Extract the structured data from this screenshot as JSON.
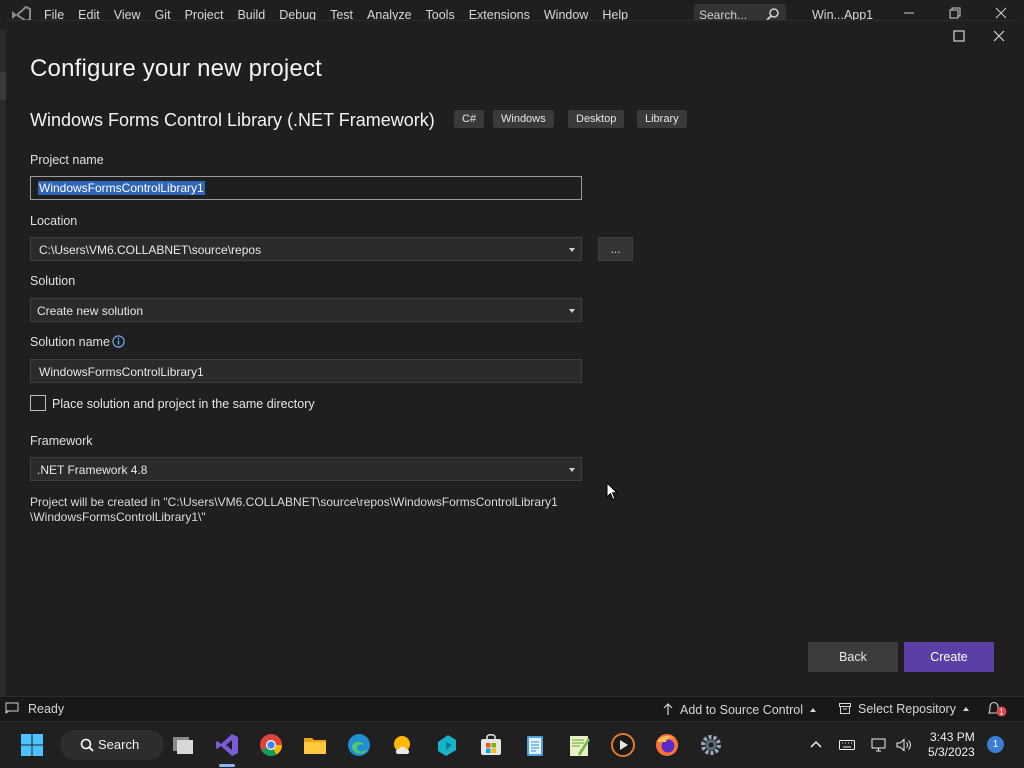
{
  "app": {
    "menu": [
      "File",
      "Edit",
      "View",
      "Git",
      "Project",
      "Build",
      "Debug",
      "Test",
      "Analyze",
      "Tools",
      "Extensions",
      "Window",
      "Help"
    ],
    "search_placeholder": "Search...",
    "window_title": "Win...App1"
  },
  "dialog": {
    "title": "Configure your new project",
    "template_name": "Windows Forms Control Library (.NET Framework)",
    "tags": [
      "C#",
      "Windows",
      "Desktop",
      "Library"
    ],
    "project_name_label": "Project name",
    "project_name_value": "WindowsFormsControlLibrary1",
    "location_label": "Location",
    "location_value": "C:\\Users\\VM6.COLLABNET\\source\\repos",
    "browse_label": "...",
    "solution_label": "Solution",
    "solution_value": "Create new solution",
    "solution_name_label": "Solution name",
    "solution_name_value": "WindowsFormsControlLibrary1",
    "same_dir_label": "Place solution and project in the same directory",
    "same_dir_checked": false,
    "framework_label": "Framework",
    "framework_value": ".NET Framework 4.8",
    "path_note_line1": "Project will be created in \"C:\\Users\\VM6.COLLABNET\\source\\repos\\WindowsFormsControlLibrary1",
    "path_note_line2": "\\WindowsFormsControlLibrary1\\\"",
    "back_label": "Back",
    "create_label": "Create"
  },
  "status_bar": {
    "status": "Ready",
    "source_control": "Add to Source Control",
    "repository": "Select Repository",
    "notification_count": "1"
  },
  "taskbar": {
    "search_label": "Search",
    "time": "3:43 PM",
    "date": "5/3/2023",
    "notification_count": "1",
    "apps": [
      "windows-start-icon",
      "task-view-icon",
      "visual-studio-icon",
      "chrome-icon",
      "file-explorer-icon",
      "edge-icon",
      "weather-icon",
      "app-icon",
      "store-icon",
      "notepad-icon",
      "notepad-plus-icon",
      "media-player-icon",
      "firefox-icon",
      "settings-icon"
    ]
  },
  "colors": {
    "accent": "#5b3fa6",
    "selection": "#2f64b7",
    "background": "#1f1f1f"
  }
}
